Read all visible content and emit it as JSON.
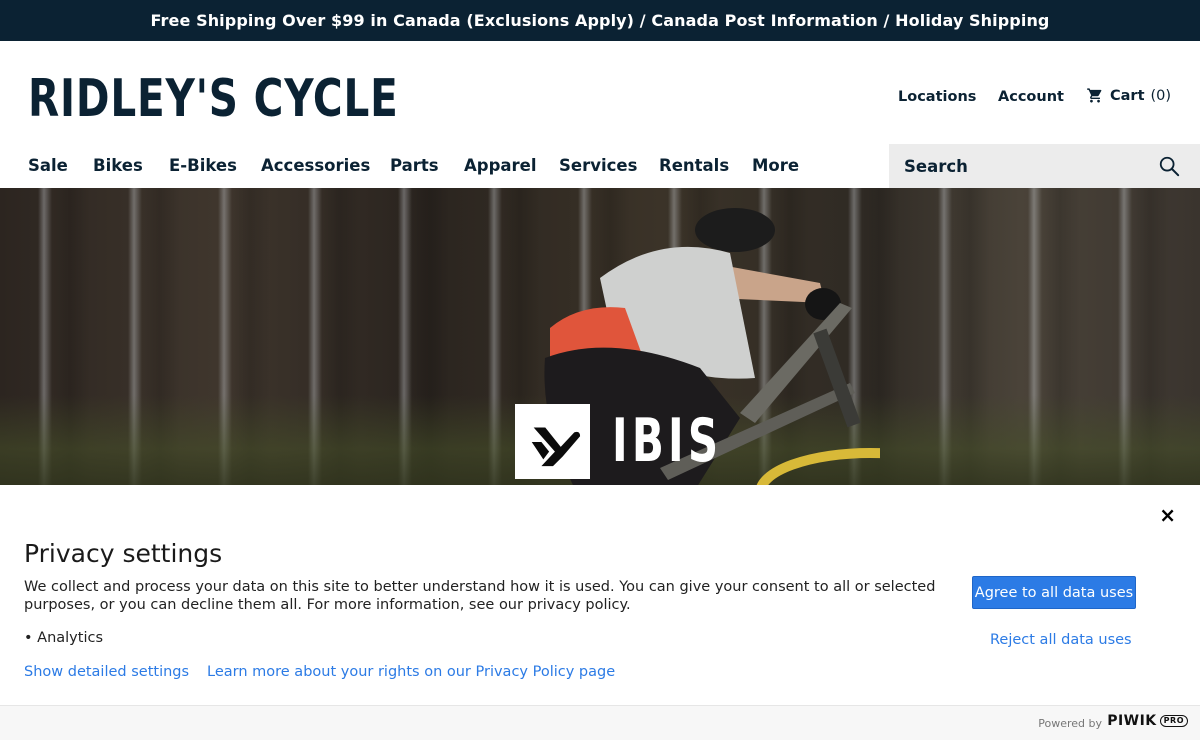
{
  "announcement": "Free Shipping Over $99 in Canada (Exclusions Apply) / Canada Post Information / Holiday Shipping",
  "header": {
    "logo": "RIDLEY'S CYCLE",
    "locations": "Locations",
    "account": "Account",
    "cart_label": "Cart",
    "cart_count": "(0)"
  },
  "nav": {
    "items": [
      "Sale",
      "Bikes",
      "E-Bikes",
      "Accessories",
      "Parts",
      "Apparel",
      "Services",
      "Rentals",
      "More"
    ]
  },
  "search": {
    "placeholder": "Search"
  },
  "hero": {
    "brand": "IBIS"
  },
  "privacy": {
    "title": "Privacy settings",
    "description": "We collect and process your data on this site to better understand how it is used. You can give your consent to all or selected purposes, or you can decline them all. For more information, see our privacy policy.",
    "purpose": "• Analytics",
    "show_settings": "Show detailed settings",
    "learn_more": "Learn more about your rights on our Privacy Policy page",
    "agree": "Agree to all data uses",
    "reject": "Reject all data uses",
    "close": "×"
  },
  "footer": {
    "powered_by": "Powered by",
    "brand": "PIWIK",
    "badge": "PRO"
  },
  "colors": {
    "navy": "#0b2233",
    "link_blue": "#2c7be5",
    "search_bg": "#ececec"
  }
}
